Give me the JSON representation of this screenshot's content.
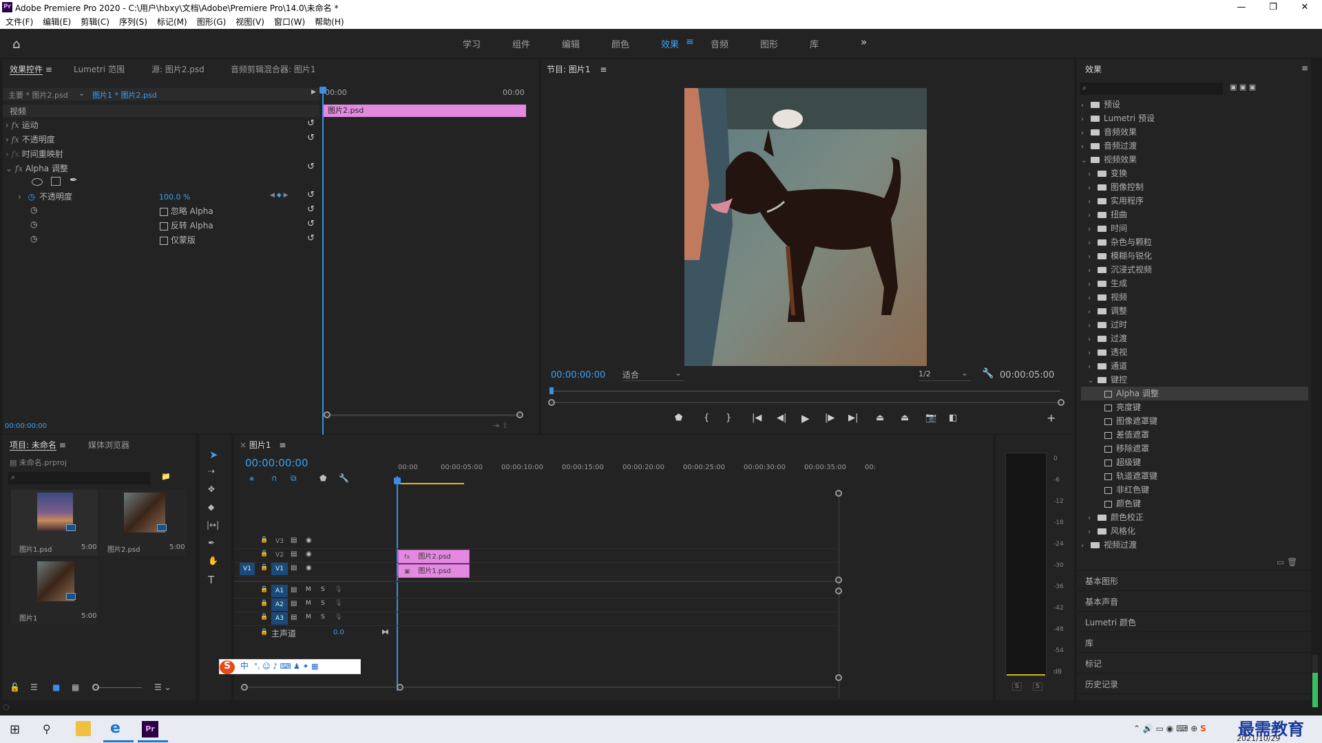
{
  "window": {
    "title": "Adobe Premiere Pro 2020 - C:\\用户\\hbxy\\文档\\Adobe\\Premiere Pro\\14.0\\未命名 *",
    "logo": "Pr"
  },
  "menu": [
    "文件(F)",
    "编辑(E)",
    "剪辑(C)",
    "序列(S)",
    "标记(M)",
    "图形(G)",
    "视图(V)",
    "窗口(W)",
    "帮助(H)"
  ],
  "workspaces": [
    "学习",
    "组件",
    "编辑",
    "颜色",
    "效果",
    "音频",
    "图形",
    "库"
  ],
  "active_workspace": "效果",
  "effect_controls": {
    "tabs": [
      "效果控件",
      "Lumetri 范围",
      "源: 图片2.psd",
      "音频剪辑混合器: 图片1"
    ],
    "master": "主要 * 图片2.psd",
    "clip": "图片1 * 图片2.psd",
    "time_start": "00:00",
    "time_end": "00:00",
    "clip_label": "图片2.psd",
    "section": "视频",
    "rows": [
      "运动",
      "不透明度",
      "时间重映射",
      "Alpha 调整"
    ],
    "opacity_label": "不透明度",
    "opacity_value": "100.0 %",
    "checkboxes": [
      "忽略 Alpha",
      "反转 Alpha",
      "仅蒙版"
    ],
    "timecode": "00:00:00:00"
  },
  "program": {
    "title": "节目: 图片1",
    "timecode": "00:00:00:00",
    "fit": "适合",
    "quality": "1/2",
    "duration": "00:00:05:00"
  },
  "effects": {
    "title": "效果",
    "top_items": [
      "预设",
      "Lumetri 预设",
      "音频效果",
      "音频过渡",
      "视频效果"
    ],
    "video_effects": [
      "变换",
      "图像控制",
      "实用程序",
      "扭曲",
      "时间",
      "杂色与颗粒",
      "模糊与锐化",
      "沉浸式视频",
      "生成",
      "视频",
      "调整",
      "过时",
      "过渡",
      "透视",
      "通道",
      "键控"
    ],
    "keying": [
      "Alpha 调整",
      "亮度键",
      "图像遮罩键",
      "差值遮罩",
      "移除遮罩",
      "超级键",
      "轨道遮罩键",
      "非红色键",
      "颜色键"
    ],
    "after": [
      "颜色校正",
      "风格化"
    ],
    "last": "视频过渡",
    "panels": [
      "基本图形",
      "基本声音",
      "Lumetri 颜色",
      "库",
      "标记",
      "历史记录"
    ]
  },
  "project": {
    "tabs": [
      "项目: 未命名",
      "媒体浏览器"
    ],
    "file": "未命名.prproj",
    "items": [
      {
        "name": "图片1.psd",
        "dur": "5:00"
      },
      {
        "name": "图片2.psd",
        "dur": "5:00"
      },
      {
        "name": "图片1",
        "dur": "5:00"
      }
    ]
  },
  "timeline": {
    "title": "图片1",
    "timecode": "00:00:00:00",
    "ruler": [
      "00:00",
      "00:00:05:00",
      "00:00:10:00",
      "00:00:15:00",
      "00:00:20:00",
      "00:00:25:00",
      "00:00:30:00",
      "00:00:35:00",
      "00:"
    ],
    "video_tracks": [
      "V3",
      "V2",
      "V1"
    ],
    "audio_tracks": [
      "A1",
      "A2",
      "A3"
    ],
    "source_patch_v": "V1",
    "master": "主声道",
    "master_value": "0.0",
    "clips": [
      {
        "track": "V2",
        "name": "图片2.psd"
      },
      {
        "track": "V1",
        "name": "图片1.psd"
      }
    ]
  },
  "meter": {
    "scale": [
      "0",
      "-6",
      "-12",
      "-18",
      "-24",
      "-30",
      "-36",
      "-42",
      "-48",
      "-54",
      "dB"
    ],
    "solo": [
      "S",
      "S"
    ]
  },
  "ime": {
    "label": "中"
  },
  "taskbar": {
    "date": "2021/10/29",
    "watermark": "最需教育"
  }
}
